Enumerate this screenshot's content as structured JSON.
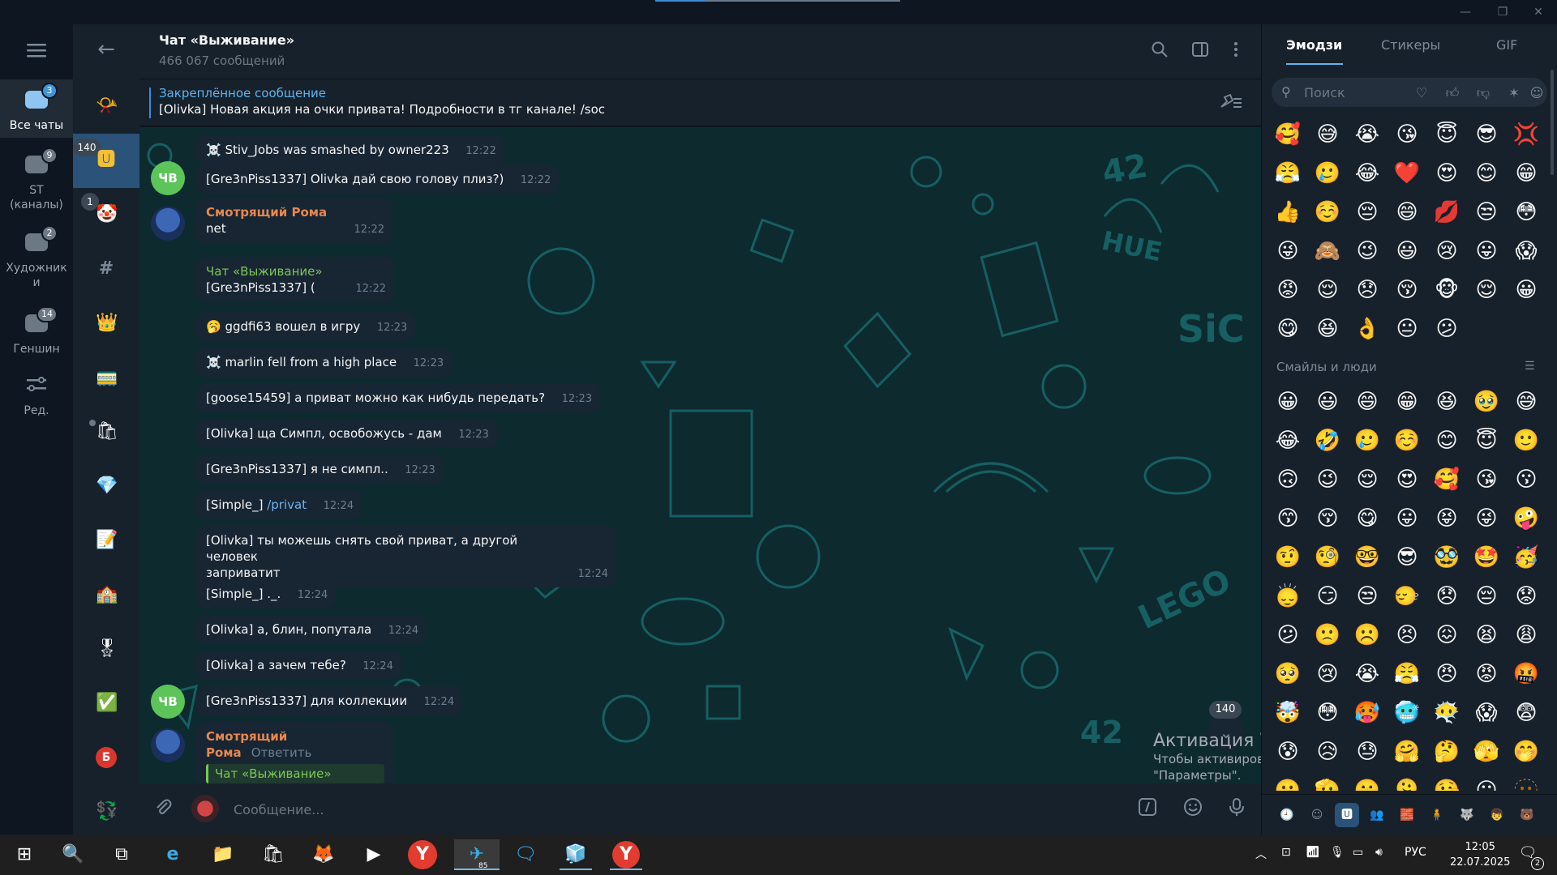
{
  "window": {
    "minimize": "—",
    "maximize": "❐",
    "close": "✕"
  },
  "folders": [
    {
      "label": "Все чаты",
      "badge": "3",
      "active": true
    },
    {
      "label": "ST (каналы)",
      "badge": "9"
    },
    {
      "label": "Художники",
      "badge": "2"
    },
    {
      "label": "Геншин",
      "badge": "14"
    },
    {
      "label": "Ред."
    }
  ],
  "chatlist": {
    "items": [
      {
        "icon": "📯"
      },
      {
        "icon": "🆄",
        "badge": "140"
      },
      {
        "icon": "🤡",
        "badge": "1"
      },
      {
        "icon": "#"
      },
      {
        "icon": "👑"
      },
      {
        "icon": "🚃"
      },
      {
        "icon": "🛍"
      },
      {
        "icon": "💎"
      },
      {
        "icon": "📝"
      },
      {
        "icon": "🏫"
      },
      {
        "icon": "🎖"
      },
      {
        "icon": "✅"
      },
      {
        "icon": "Б"
      },
      {
        "icon": "💱"
      }
    ]
  },
  "chat": {
    "title": "Чат «Выживание»",
    "subtitle": "466 067 сообщений",
    "pinned_title": "Закреплённое сообщение",
    "pinned_text": "[Olivka] Новая акция на очки привата! Подробности в тг канале! /soc"
  },
  "messages": [
    {
      "text": "☠️ Stiv_Jobs was smashed by owner223",
      "time": "12:22"
    },
    {
      "author": "[Gre3nPiss1337]",
      "text": "Olivka дай свою голову плиз?)",
      "time": "12:22",
      "avatar": "ЧВ"
    },
    {
      "name": "Смотрящий Рома",
      "text": "net",
      "time": "12:22"
    },
    {
      "name": "Чат «Выживание»",
      "author": "[Gre3nPiss1337]",
      "text": "(",
      "time": "12:22"
    },
    {
      "text": "🥱 ggdfi63 вошел в игру",
      "time": "12:23"
    },
    {
      "text": "☠️ marlin fell from a high place",
      "time": "12:23"
    },
    {
      "author": "[goose15459]",
      "text": "а приват можно как нибудь передать?",
      "time": "12:23"
    },
    {
      "author": "[Olivka]",
      "text": "ща Симпл, освобожусь - дам",
      "time": "12:23"
    },
    {
      "author": "[Gre3nPiss1337]",
      "text": "я не симпл..",
      "time": "12:23"
    },
    {
      "author": "[Simple_]",
      "text": "/privat",
      "time": "12:24"
    },
    {
      "author": "[Olivka]",
      "text": "ты можешь снять свой приват, а другой человек",
      "text2": "заприватит",
      "time": "12:24"
    },
    {
      "author": "[Simple_]",
      "text": "._.",
      "time": "12:24"
    },
    {
      "author": "[Olivka]",
      "text": "а, блин, попутала",
      "time": "12:24"
    },
    {
      "author": "[Olivka]",
      "text": "а зачем тебе?",
      "time": "12:24"
    },
    {
      "author": "[Gre3nPiss1337]",
      "text": "для коллекции",
      "time": "12:24",
      "avatar": "ЧВ"
    },
    {
      "name": "Смотрящий Рома",
      "reply": "Ответить",
      "quote": "Чат «Выживание»"
    }
  ],
  "scroll_down": {
    "badge": "140"
  },
  "watermark": {
    "line1": "Активация Windows",
    "line2": "Чтобы активировать Windows, перейдите в раздел",
    "line3": "\"Параметры\"."
  },
  "composer": {
    "placeholder": "Сообщение..."
  },
  "emoji": {
    "tabs": [
      "Эмодзи",
      "Стикеры",
      "GIF"
    ],
    "search_placeholder": "Поиск",
    "recent": [
      "🥰",
      "😅",
      "😭",
      "😘",
      "😇",
      "😎",
      "💢",
      "😤",
      "🥲",
      "😂",
      "❤️",
      "😍",
      "😊",
      "😁",
      "👍",
      "☺️",
      "😔",
      "😄",
      "💋",
      "😒",
      "😳",
      "😜",
      "🙈",
      "😉",
      "😃",
      "😢",
      "😛",
      "😱",
      "😡",
      "😌",
      "😞",
      "😚",
      "🐵",
      "😌",
      "😀",
      "😋",
      "😆",
      "👌",
      "😐",
      "😕"
    ],
    "category_title": "Смайлы и люди",
    "people": [
      "😀",
      "😃",
      "😄",
      "😁",
      "😆",
      "🥹",
      "😅",
      "😂",
      "🤣",
      "🥲",
      "☺️",
      "😊",
      "😇",
      "🙂",
      "🙃",
      "😉",
      "😌",
      "😍",
      "🥰",
      "😘",
      "😗",
      "😙",
      "😚",
      "😋",
      "😛",
      "😝",
      "😜",
      "🤪",
      "🤨",
      "🧐",
      "🤓",
      "😎",
      "🥸",
      "🤩",
      "🥳",
      "🙂‍↕️",
      "😏",
      "😒",
      "🙂‍↔️",
      "😞",
      "😔",
      "😟",
      "😕",
      "🙁",
      "☹️",
      "😣",
      "😖",
      "😫",
      "😩",
      "🥺",
      "😢",
      "😭",
      "😤",
      "😠",
      "😡",
      "🤬",
      "🤯",
      "😳",
      "🥵",
      "🥶",
      "😶‍🌫️",
      "😱",
      "😨",
      "😰",
      "😥",
      "😓",
      "🤗",
      "🤔",
      "🫣",
      "🤭",
      "🫢",
      "🫡",
      "🤫",
      "🫠",
      "🤥",
      "😶",
      "🫥"
    ],
    "packs": [
      "🕘",
      "☺",
      "🆄",
      "👥",
      "🧱",
      "🧍",
      "🐺",
      "👦",
      "🐻"
    ]
  },
  "taskbar": {
    "apps": [
      "⊞",
      "🔍",
      "⧉",
      "e",
      "📁",
      "🛍",
      "🦊",
      "▶",
      "Y",
      "✈",
      "🗨",
      "🧊",
      "Y"
    ],
    "telegram_badge": "85",
    "lang": "РУС",
    "time": "12:05",
    "date": "22.07.2025",
    "notif_badge": "2"
  }
}
